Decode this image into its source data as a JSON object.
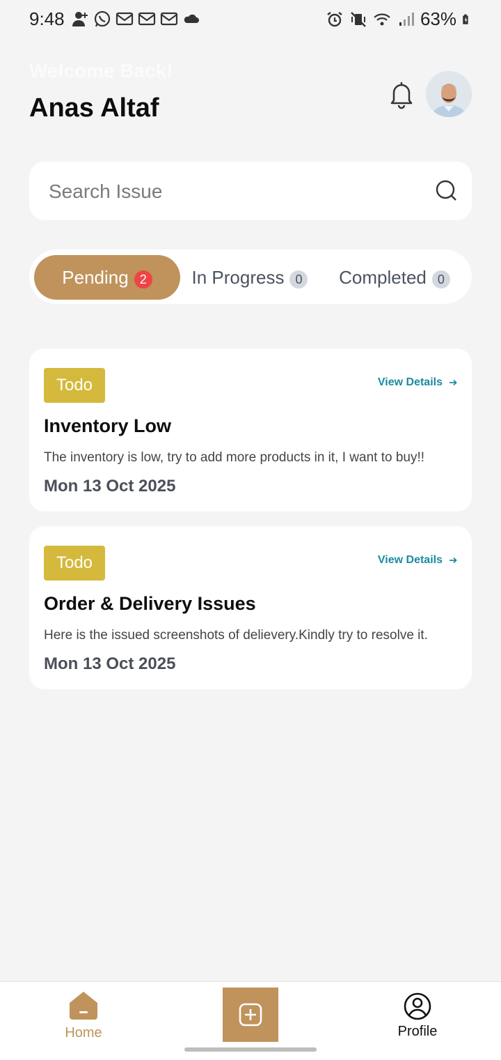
{
  "status_bar": {
    "time": "9:48",
    "battery": "63%",
    "icons_left": [
      "add-contact-icon",
      "whatsapp-icon",
      "gmail-icon",
      "gmail-icon",
      "gmail-icon",
      "cloud-icon"
    ],
    "icons_right": [
      "alarm-icon",
      "vibrate-off-icon",
      "wifi-icon",
      "signal-icon",
      "battery-icon"
    ]
  },
  "header": {
    "welcome": "Welcome Back!",
    "user_name": "Anas Altaf"
  },
  "search": {
    "placeholder": "Search Issue",
    "value": ""
  },
  "tabs": [
    {
      "label": "Pending",
      "count": "2",
      "active": true
    },
    {
      "label": "In Progress",
      "count": "0",
      "active": false
    },
    {
      "label": "Completed",
      "count": "0",
      "active": false
    }
  ],
  "issues": [
    {
      "status": "Todo",
      "view_label": "View Details",
      "title": "Inventory Low",
      "description": "The inventory is low, try to add more products in it, I want to buy!!",
      "date": "Mon 13 Oct 2025"
    },
    {
      "status": "Todo",
      "view_label": "View Details",
      "title": "Order & Delivery Issues",
      "description": "Here is the issued screenshots of delievery.Kindly try to resolve it.",
      "date": "Mon 13 Oct 2025"
    }
  ],
  "bottom_nav": {
    "home_label": "Home",
    "profile_label": "Profile"
  },
  "colors": {
    "accent": "#c0935c",
    "badge": "#d4b93c",
    "link": "#1a8ba0",
    "background": "#f4f4f4",
    "count_red": "#ef4444"
  }
}
